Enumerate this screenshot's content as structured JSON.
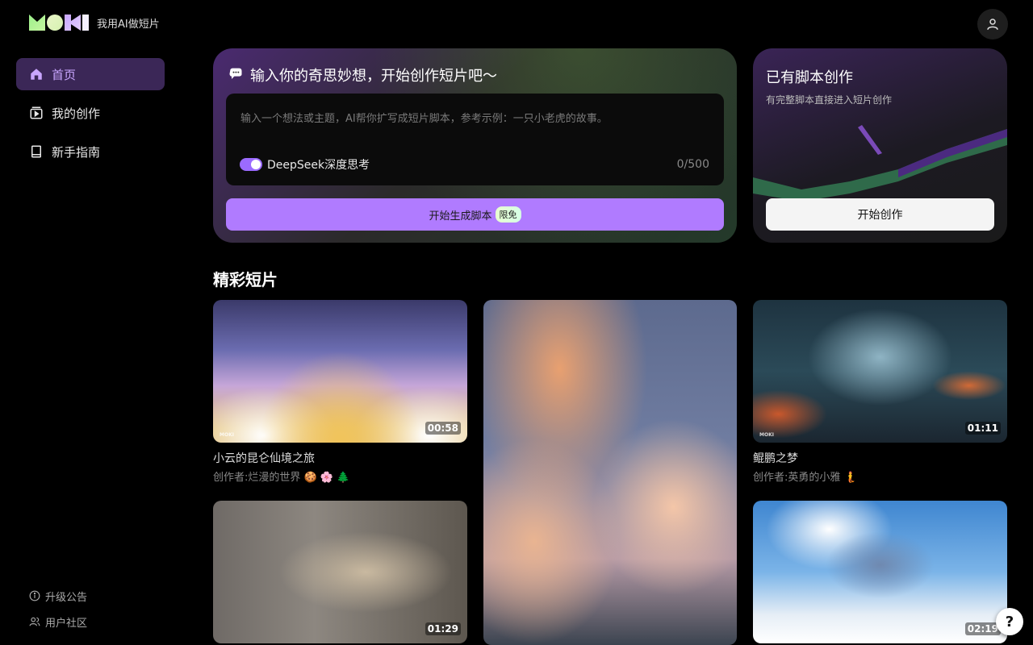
{
  "brand": {
    "slogan": "我用AI做短片"
  },
  "sidebar": {
    "items": [
      {
        "label": "首页",
        "icon": "home-icon",
        "active": true
      },
      {
        "label": "我的创作",
        "icon": "video-folder-icon",
        "active": false
      },
      {
        "label": "新手指南",
        "icon": "book-icon",
        "active": false
      }
    ],
    "footer": [
      {
        "label": "升级公告",
        "icon": "info-icon"
      },
      {
        "label": "用户社区",
        "icon": "users-icon"
      }
    ]
  },
  "create": {
    "title": "输入你的奇思妙想，开始创作短片吧～",
    "placeholder": "输入一个想法或主题，AI帮你扩写成短片脚本，参考示例：一只小老虎的故事。",
    "toggle_label": "DeepSeek深度思考",
    "toggle_on": true,
    "counter": "0/500",
    "button_label": "开始生成脚本",
    "button_badge": "限免"
  },
  "script": {
    "title": "已有脚本创作",
    "subtitle": "有完整脚本直接进入短片创作",
    "button_label": "开始创作"
  },
  "gallery": {
    "title": "精彩短片",
    "cards": [
      {
        "title": "小云的昆仑仙境之旅",
        "author": "创作者:烂漫的世界 🍪 🌸 🌲",
        "duration": "00:58"
      },
      {
        "title": "",
        "author": "",
        "duration": ""
      },
      {
        "title": "鲲鹏之梦",
        "author": "创作者:英勇的小雅 🧜",
        "duration": "01:11"
      },
      {
        "title": "",
        "author": "",
        "duration": "01:29"
      },
      {
        "title": "",
        "author": "",
        "duration": "02:19"
      }
    ]
  },
  "help": {
    "label": "?"
  },
  "colors": {
    "accent": "#b07bff",
    "active_bg": "#3b2757",
    "active_text": "#c9a6ff"
  }
}
